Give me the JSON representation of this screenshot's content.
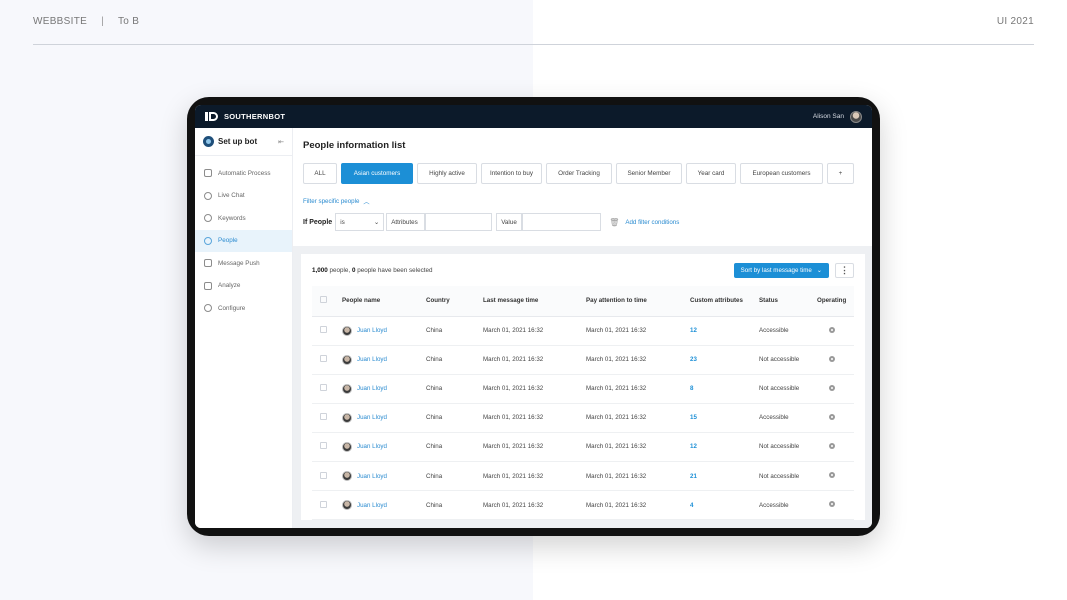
{
  "page_header": {
    "left": "WEBBSITE",
    "separator": "|",
    "tag": "To B",
    "right": "UI 2021"
  },
  "app": {
    "brand": "SOUTHERNBOT",
    "user_name": "Alison San"
  },
  "sidebar": {
    "title": "Set up bot",
    "items": [
      {
        "label": "Automatic Process",
        "icon": "process-icon"
      },
      {
        "label": "Live Chat",
        "icon": "chat-icon"
      },
      {
        "label": "Keywords",
        "icon": "keywords-icon"
      },
      {
        "label": "People",
        "icon": "people-icon",
        "active": true
      },
      {
        "label": "Message Push",
        "icon": "message-push-icon"
      },
      {
        "label": "Analyze",
        "icon": "analyze-icon"
      },
      {
        "label": "Configure",
        "icon": "configure-icon"
      }
    ]
  },
  "main": {
    "title": "People information list",
    "tabs": [
      "ALL",
      "Asian customers",
      "Highly active",
      "Intention to buy",
      "Order Tracking",
      "Senior Member",
      "Year card",
      "European customers"
    ],
    "active_tab": "Asian customers",
    "add_tab_label": "+",
    "filter_toggle": "Filter specific people",
    "filter": {
      "label": "If People",
      "operator": "is",
      "attributes_label": "Attributes",
      "value_label": "Value",
      "add_condition": "Add filter conditions"
    },
    "count": {
      "total": "1,000",
      "people_text": "people,",
      "selected": "0",
      "selected_text": "people have been selected"
    },
    "sort_label": "Sort by last message time",
    "columns": [
      "People name",
      "Country",
      "Last message time",
      "Pay attention to time",
      "Custom attributes",
      "Status",
      "Operating"
    ],
    "rows": [
      {
        "name": "Juan Lloyd",
        "country": "China",
        "last": "March 01, 2021 16:32",
        "attention": "March 01, 2021 16:32",
        "attrs": "12",
        "status": "Accessible"
      },
      {
        "name": "Juan Lloyd",
        "country": "China",
        "last": "March 01, 2021 16:32",
        "attention": "March 01, 2021 16:32",
        "attrs": "23",
        "status": "Not accessible"
      },
      {
        "name": "Juan Lloyd",
        "country": "China",
        "last": "March 01, 2021 16:32",
        "attention": "March 01, 2021 16:32",
        "attrs": "8",
        "status": "Not accessible"
      },
      {
        "name": "Juan Lloyd",
        "country": "China",
        "last": "March 01, 2021 16:32",
        "attention": "March 01, 2021 16:32",
        "attrs": "15",
        "status": "Accessible"
      },
      {
        "name": "Juan Lloyd",
        "country": "China",
        "last": "March 01, 2021 16:32",
        "attention": "March 01, 2021 16:32",
        "attrs": "12",
        "status": "Not accessible"
      },
      {
        "name": "Juan Lloyd",
        "country": "China",
        "last": "March 01, 2021 16:32",
        "attention": "March 01, 2021 16:32",
        "attrs": "21",
        "status": "Not accessible"
      },
      {
        "name": "Juan Lloyd",
        "country": "China",
        "last": "March 01, 2021 16:32",
        "attention": "March 01, 2021 16:32",
        "attrs": "4",
        "status": "Accessible"
      }
    ]
  },
  "colors": {
    "accent": "#1c8fd6",
    "topbar": "#0c1a2a",
    "device": "#111111"
  }
}
